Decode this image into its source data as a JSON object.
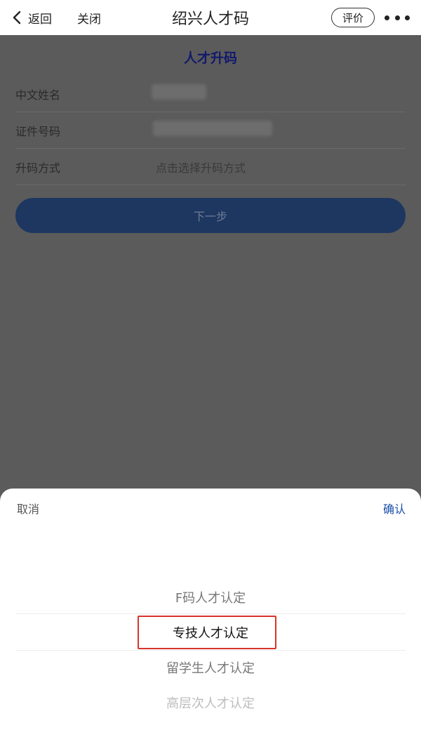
{
  "navbar": {
    "back_label": "返回",
    "close_label": "关闭",
    "title": "绍兴人才码",
    "rate_label": "评价",
    "more_icon": "more-dots-icon"
  },
  "form": {
    "title": "人才升码",
    "rows": [
      {
        "label": "中文姓名",
        "value": ""
      },
      {
        "label": "证件号码",
        "value": ""
      },
      {
        "label": "升码方式",
        "value": "点击选择升码方式"
      }
    ],
    "next_label": "下一步"
  },
  "picker": {
    "cancel_label": "取消",
    "confirm_label": "确认",
    "options": [
      "F码人才认定",
      "专技人才认定",
      "留学生人才认定",
      "高层次人才认定"
    ],
    "selected_index": 1
  },
  "colors": {
    "title_blue": "#13196b",
    "button_dark": "#1e3761",
    "confirm_blue": "#1a4fa8",
    "highlight_red": "#d9342b"
  }
}
